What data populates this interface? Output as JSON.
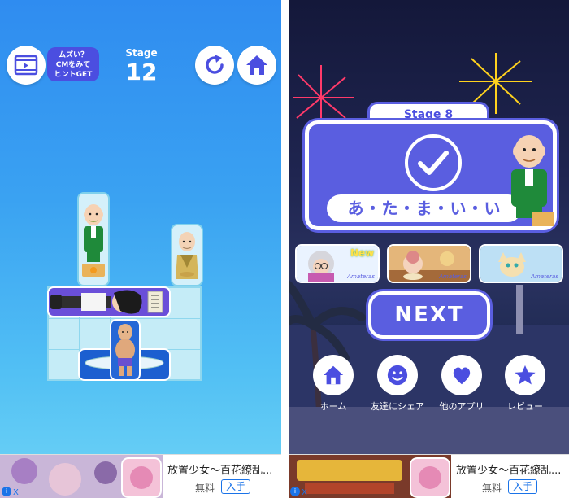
{
  "left": {
    "hint_line1": "ムズい？",
    "hint_line2": "CMをみて",
    "hint_line3": "ヒントGET",
    "stage_label": "Stage",
    "stage_number": "12",
    "icons": [
      "video-icon",
      "refresh-icon",
      "home-icon"
    ],
    "ad": {
      "title": "放置少女〜百花繚乱...",
      "free": "無料",
      "install": "入手",
      "info": "i",
      "close": "X"
    }
  },
  "right": {
    "stage_label": "Stage 8",
    "answer": "あ・た・ま・い・い",
    "thumbs": [
      {
        "badge": "New",
        "label": "Amateras"
      },
      {
        "badge": "",
        "label": "Amateras"
      },
      {
        "badge": "",
        "label": "Amateras"
      }
    ],
    "next_label": "NEXT",
    "nav": [
      {
        "label": "ホーム",
        "icon": "home-icon"
      },
      {
        "label": "友達にシェア",
        "icon": "smile-icon"
      },
      {
        "label": "他のアプリ",
        "icon": "heart-icon"
      },
      {
        "label": "レビュー",
        "icon": "star-icon"
      }
    ],
    "ad": {
      "title": "放置少女〜百花繚乱...",
      "free": "無料",
      "install": "入手",
      "info": "i",
      "close": "X"
    }
  },
  "colors": {
    "accent": "#5a5ee0",
    "left_bg_top": "#2f8cf0",
    "right_bg_top": "#14183a"
  }
}
